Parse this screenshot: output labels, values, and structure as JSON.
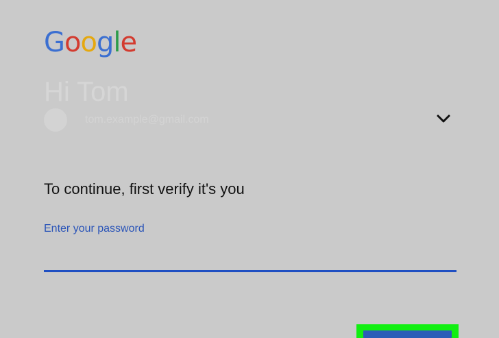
{
  "logo": {
    "letters": [
      "G",
      "o",
      "o",
      "g",
      "l",
      "e"
    ],
    "colors": {
      "blue": "#3b6fd1",
      "red": "#d33b2f",
      "yellow": "#e5a80f",
      "green": "#2d9c4a"
    }
  },
  "account": {
    "greeting": "Hi Tom",
    "email": "tom.example@gmail.com",
    "expand_icon": "chevron-down-icon"
  },
  "form": {
    "prompt": "To continue, first verify it's you",
    "password_label": "Enter your password",
    "password_value": ""
  },
  "colors": {
    "background": "#cacaca",
    "accent": "#1f4fc2",
    "highlight": "#11ef11"
  }
}
